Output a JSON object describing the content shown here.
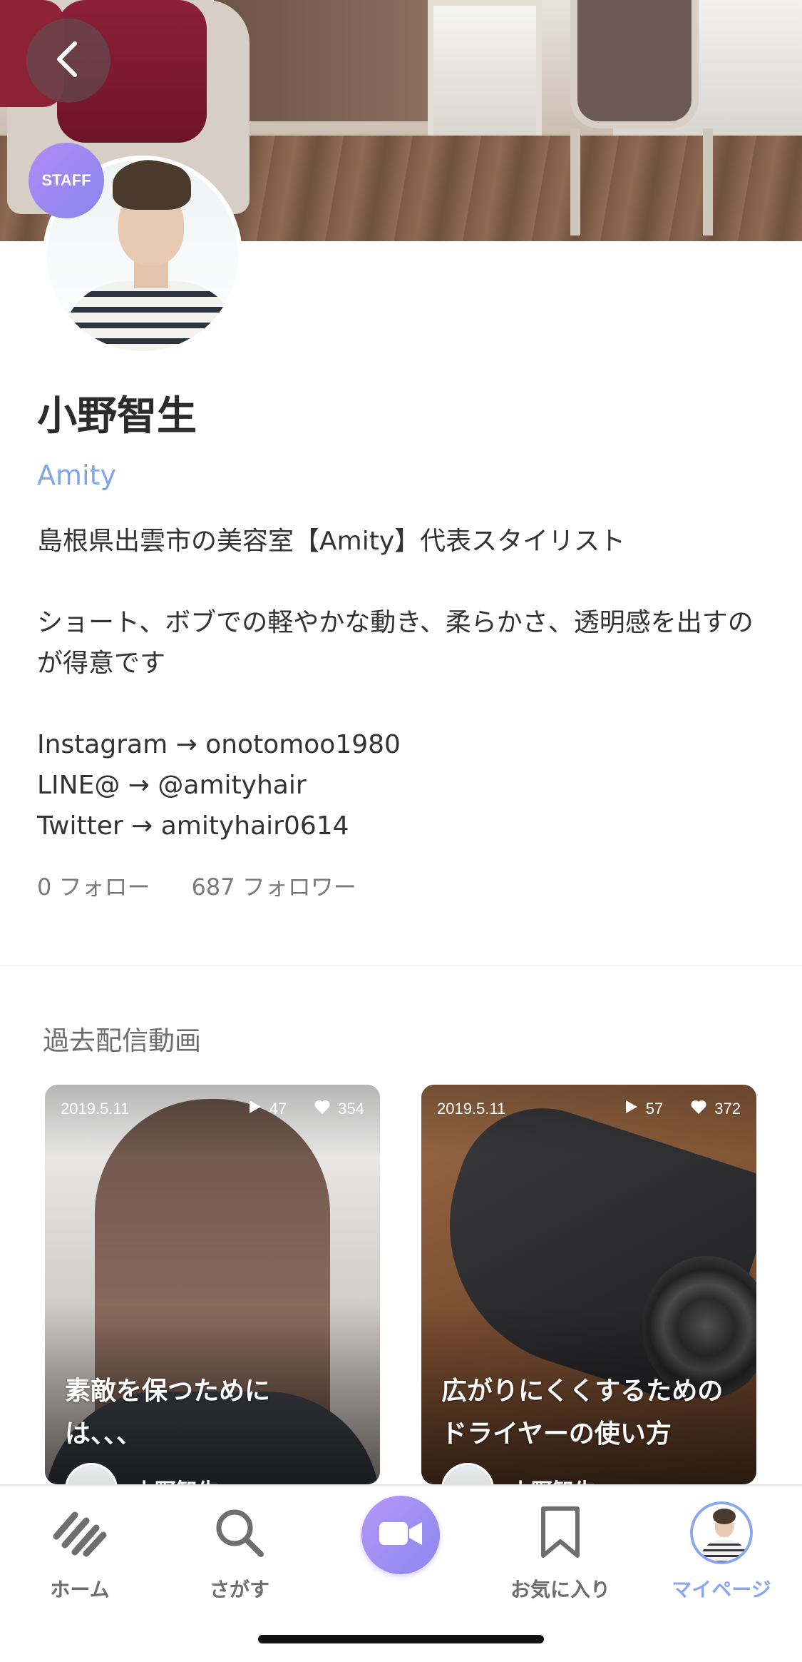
{
  "header": {
    "back_icon": "chevron-left-icon",
    "staff_badge": "STAFF"
  },
  "profile": {
    "name": "小野智生",
    "salon": "Amity",
    "bio": "島根県出雲市の美容室【Amity】代表スタイリスト\n\nショート、ボブでの軽やかな動き、柔らかさ、透明感を出すのが得意です\n\nInstagram →  onotomoo1980\nLINE@       →  @amityhair\nTwitter      →   amityhair0614",
    "following": "0 フォロー",
    "followers": "687 フォロワー"
  },
  "videos": {
    "section_title": "過去配信動画",
    "items": [
      {
        "date": "2019.5.11",
        "plays": "47",
        "likes": "354",
        "title": "素敵を保つために\nは、、、",
        "author": "小野智生"
      },
      {
        "date": "2019.5.11",
        "plays": "57",
        "likes": "372",
        "title": "広がりにくくするための\nドライヤーの使い方",
        "author": "小野智生"
      }
    ]
  },
  "tabbar": {
    "home": "ホーム",
    "search": "さがす",
    "favorites": "お気に入り",
    "mypage": "マイページ",
    "post_icon": "video-camera-icon"
  },
  "colors": {
    "accent": "#8aa8ef",
    "salon_link": "#7fa6e6",
    "badge": "#9d88f2"
  }
}
